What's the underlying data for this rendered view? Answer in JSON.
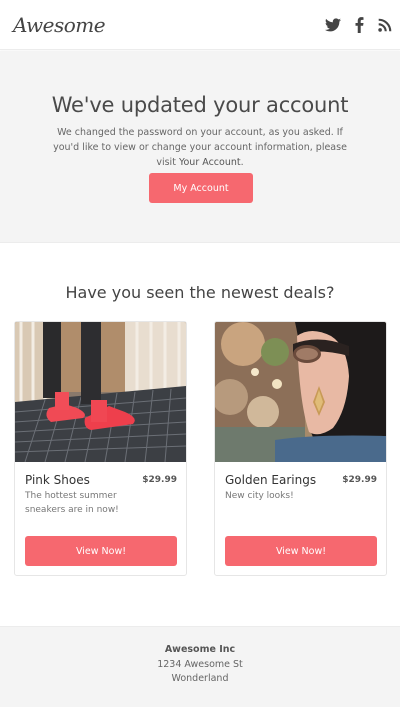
{
  "header": {
    "logo": "Awesome",
    "social_icons": [
      "twitter-icon",
      "facebook-icon",
      "rss-icon"
    ],
    "icon_color": "#444444"
  },
  "hero": {
    "title": "We've updated your account",
    "body_before_link": "We changed the password on your account, as you asked. If you'd like to view or change your account information, please visit ",
    "body_link": "Your Account",
    "body_after_link": ".",
    "button_label": "My Account",
    "background": "#f4f4f4"
  },
  "deals": {
    "title": "Have you seen the newest deals?",
    "products": [
      {
        "name": "Pink Shoes",
        "price": "$29.99",
        "description": "The hottest summer sneakers are in now!",
        "button_label": "View Now!"
      },
      {
        "name": "Golden Earings",
        "price": "$29.99",
        "description": "New city looks!",
        "button_label": "View Now!"
      }
    ]
  },
  "footer": {
    "company": "Awesome Inc",
    "street": "1234 Awesome St",
    "city": "Wonderland"
  },
  "colors": {
    "accent": "#f6686f",
    "panel": "#f4f4f4",
    "text": "#555555"
  }
}
